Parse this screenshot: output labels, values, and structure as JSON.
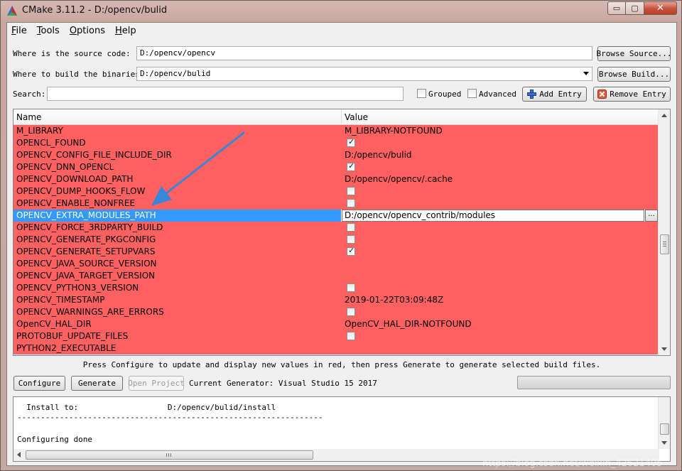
{
  "window": {
    "title": "CMake 3.11.2 - D:/opencv/bulid",
    "minimize_glyph": "▭",
    "maximize_glyph": "▢",
    "close_glyph": "✕"
  },
  "menu": [
    {
      "label": "File",
      "accel": "F",
      "rest": "ile"
    },
    {
      "label": "Tools",
      "accel": "T",
      "rest": "ools"
    },
    {
      "label": "Options",
      "accel": "O",
      "rest": "ptions"
    },
    {
      "label": "Help",
      "accel": "H",
      "rest": "elp"
    }
  ],
  "source": {
    "label": "Where is the source code:",
    "value": "D:/opencv/opencv",
    "browse_label": "Browse Source..."
  },
  "binaries": {
    "label": "Where to build the binaries:",
    "value": "D:/opencv/bulid",
    "browse_label": "Browse Build..."
  },
  "search": {
    "label": "Search:",
    "value": "",
    "grouped_label": "Grouped",
    "grouped_checked": false,
    "advanced_label": "Advanced",
    "advanced_checked": false,
    "add_entry_label": "Add Entry",
    "remove_entry_label": "Remove Entry"
  },
  "table": {
    "headers": {
      "name": "Name",
      "value": "Value"
    },
    "row_color": "#ff6161",
    "selected_color": "#3399ff",
    "rows": [
      {
        "name": "M_LIBRARY",
        "value": "M_LIBRARY-NOTFOUND"
      },
      {
        "name": "OPENCL_FOUND",
        "checkbox": true
      },
      {
        "name": "OPENCV_CONFIG_FILE_INCLUDE_DIR",
        "value": "D:/opencv/bulid"
      },
      {
        "name": "OPENCV_DNN_OPENCL",
        "checkbox": true
      },
      {
        "name": "OPENCV_DOWNLOAD_PATH",
        "value": "D:/opencv/opencv/.cache"
      },
      {
        "name": "OPENCV_DUMP_HOOKS_FLOW",
        "checkbox": false
      },
      {
        "name": "OPENCV_ENABLE_NONFREE",
        "checkbox": false
      },
      {
        "name": "OPENCV_EXTRA_MODULES_PATH",
        "value": "D:/opencv/opencv_contrib/modules",
        "selected": true,
        "button": "..."
      },
      {
        "name": "OPENCV_FORCE_3RDPARTY_BUILD",
        "checkbox": false
      },
      {
        "name": "OPENCV_GENERATE_PKGCONFIG",
        "checkbox": false
      },
      {
        "name": "OPENCV_GENERATE_SETUPVARS",
        "checkbox": true
      },
      {
        "name": "OPENCV_JAVA_SOURCE_VERSION",
        "value": ""
      },
      {
        "name": "OPENCV_JAVA_TARGET_VERSION",
        "value": ""
      },
      {
        "name": "OPENCV_PYTHON3_VERSION",
        "checkbox": false
      },
      {
        "name": "OPENCV_TIMESTAMP",
        "value": "2019-01-22T03:09:48Z"
      },
      {
        "name": "OPENCV_WARNINGS_ARE_ERRORS",
        "checkbox": false
      },
      {
        "name": "OpenCV_HAL_DIR",
        "value": "OpenCV_HAL_DIR-NOTFOUND"
      },
      {
        "name": "PROTOBUF_UPDATE_FILES",
        "checkbox": false
      },
      {
        "name": "PYTHON2_EXECUTABLE",
        "value": ""
      }
    ]
  },
  "status_message": "Press Configure to update and display new values in red, then press Generate to generate selected build files.",
  "actions": {
    "configure_label": "Configure",
    "generate_label": "Generate",
    "open_project_label": "Open Project",
    "generator_text": "Current Generator: Visual Studio 15 2017"
  },
  "output": {
    "lines": [
      "  Install to:                   D:/opencv/bulid/install",
      "-----------------------------------------------------------------",
      "",
      "Configuring done"
    ]
  },
  "watermark": "https://blog.csdn.net/weixin_42621405"
}
